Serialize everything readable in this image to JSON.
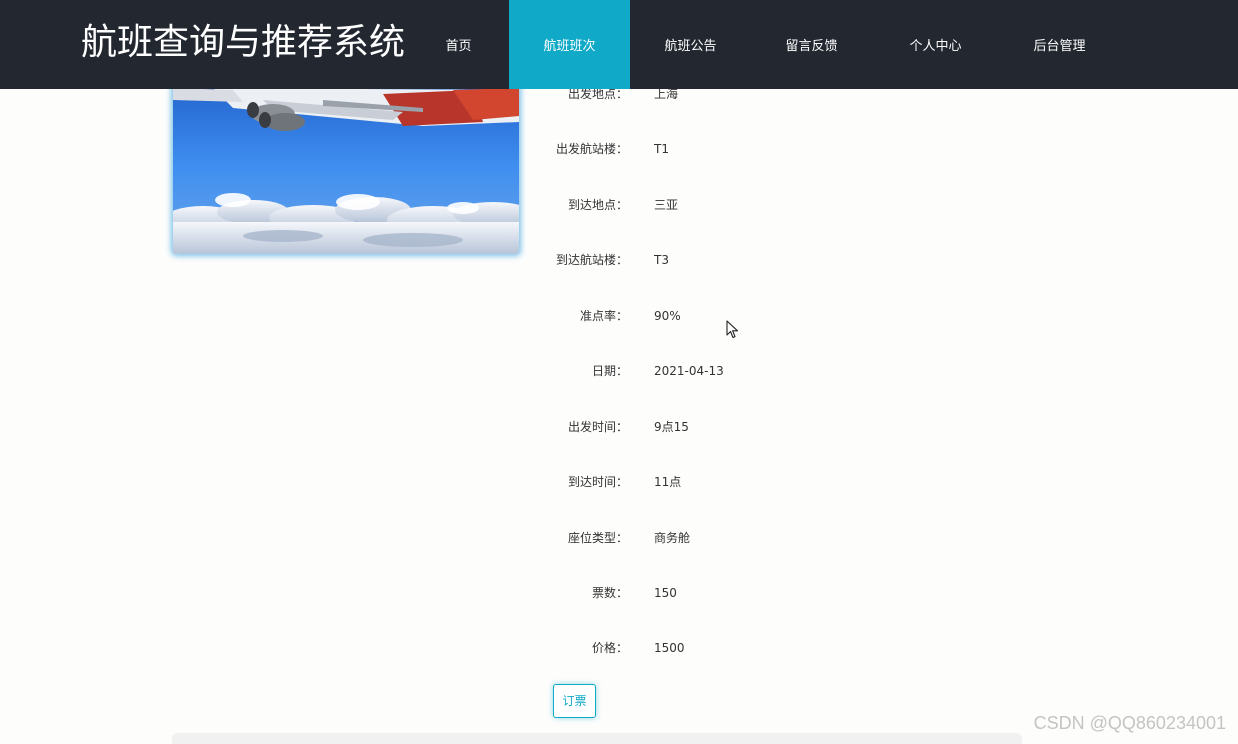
{
  "header": {
    "site_title": "航班查询与推荐系统",
    "nav": [
      {
        "label": "首页",
        "active": false
      },
      {
        "label": "航班班次",
        "active": true
      },
      {
        "label": "航班公告",
        "active": false
      },
      {
        "label": "留言反馈",
        "active": false
      },
      {
        "label": "个人中心",
        "active": false
      },
      {
        "label": "后台管理",
        "active": false
      }
    ]
  },
  "flight": {
    "details": [
      {
        "label": "出发地点：",
        "value": "上海"
      },
      {
        "label": "出发航站楼：",
        "value": "T1"
      },
      {
        "label": "到达地点：",
        "value": "三亚"
      },
      {
        "label": "到达航站楼：",
        "value": "T3"
      },
      {
        "label": "准点率：",
        "value": "90%"
      },
      {
        "label": "日期：",
        "value": "2021-04-13"
      },
      {
        "label": "出发时间：",
        "value": "9点15"
      },
      {
        "label": "到达时间：",
        "value": "11点"
      },
      {
        "label": "座位类型：",
        "value": "商务舱"
      },
      {
        "label": "票数：",
        "value": "150"
      },
      {
        "label": "价格：",
        "value": "1500"
      }
    ],
    "book_label": "订票"
  },
  "watermark": "CSDN @QQ860234001",
  "colors": {
    "header_bg": "#222730",
    "accent": "#10a9c7",
    "text": "#333333"
  }
}
